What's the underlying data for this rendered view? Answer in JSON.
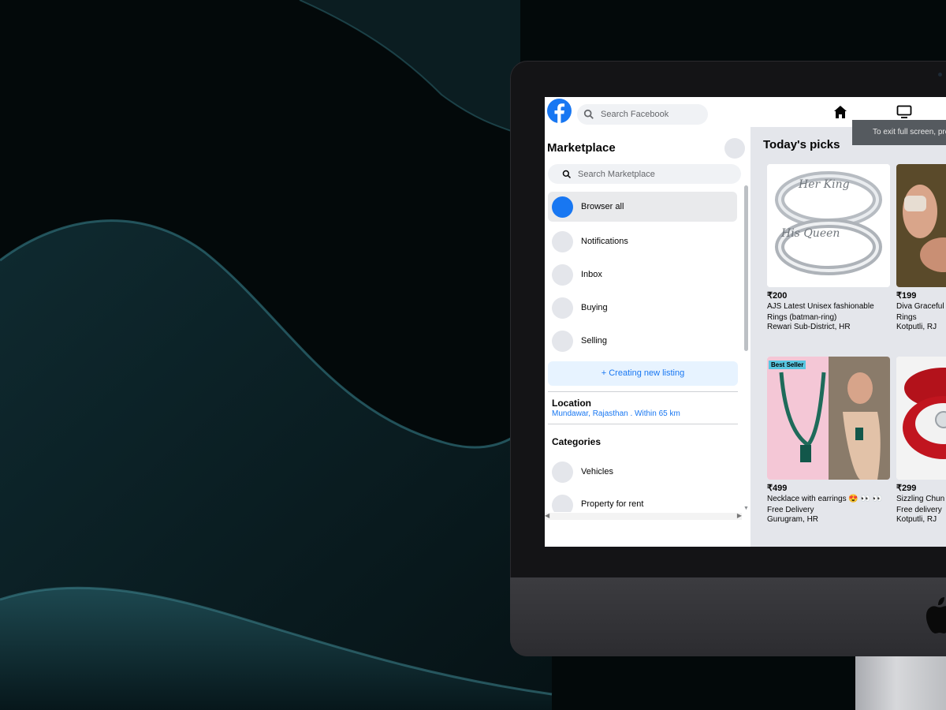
{
  "topbar": {
    "search_placeholder": "Search Facebook",
    "fullscreen_tip": "To exit full screen, press"
  },
  "sidebar": {
    "title": "Marketplace",
    "search_placeholder": "Search Marketplace",
    "items": [
      {
        "label": "Browser all"
      },
      {
        "label": "Notifications"
      },
      {
        "label": "Inbox"
      },
      {
        "label": "Buying"
      },
      {
        "label": "Selling"
      }
    ],
    "create_label": "+ Creating new listing",
    "location_title": "Location",
    "location_value": "Mundawar, Rajasthan . Within 65 km",
    "categories_title": "Categories",
    "categories": [
      {
        "label": "Vehicles"
      },
      {
        "label": "Property for rent"
      }
    ]
  },
  "feed": {
    "title": "Today's picks",
    "cards": [
      {
        "price": "₹200",
        "name1": "AJS Latest Unisex fashionable",
        "name2": "Rings (batman-ring)",
        "place": "Rewari Sub-District, HR",
        "img_text1": "Her King",
        "img_text2": "His Queen"
      },
      {
        "price": "₹199",
        "name1": "Diva Graceful",
        "name2": "Rings",
        "place": "Kotputli, RJ"
      },
      {
        "price": "₹499",
        "name1": "Necklace with earrings 😍 👀 👀",
        "name2": "Free Delivery",
        "place": "Gurugram, HR",
        "badge": "Best Seller"
      },
      {
        "price": "₹299",
        "name1": "Sizzling Chun",
        "name2": "Free delivery",
        "place": "Kotputli, RJ"
      }
    ]
  },
  "colors": {
    "brand": "#1877f2",
    "feed_bg": "#e4e6eb",
    "desk_bg": "#040809"
  }
}
